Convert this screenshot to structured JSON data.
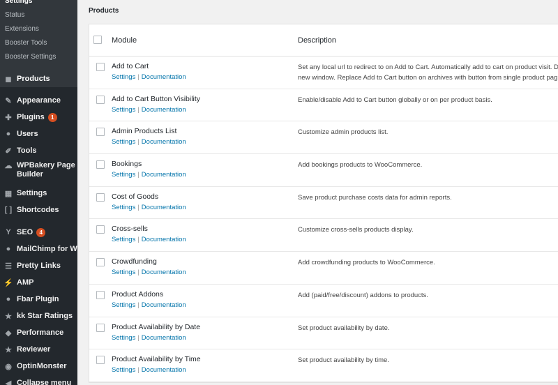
{
  "sidebar": {
    "submenu": [
      {
        "label": "Settings",
        "current": true
      },
      {
        "label": "Status"
      },
      {
        "label": "Extensions"
      },
      {
        "label": "Booster Tools"
      },
      {
        "label": "Booster Settings"
      }
    ],
    "menu": [
      {
        "label": "Products",
        "icon": "products-icon",
        "glyph": "◼"
      },
      {
        "label": "Appearance",
        "icon": "paintbrush-icon",
        "glyph": "✎"
      },
      {
        "label": "Plugins",
        "icon": "plugin-icon",
        "glyph": "✚",
        "badge": "1"
      },
      {
        "label": "Users",
        "icon": "users-icon",
        "glyph": "●"
      },
      {
        "label": "Tools",
        "icon": "wrench-icon",
        "glyph": "✐"
      },
      {
        "label": "WPBakery Page Builder",
        "icon": "wpbakery-icon",
        "glyph": "☁"
      },
      {
        "label": "Settings",
        "icon": "settings-icon",
        "glyph": "▦"
      },
      {
        "label": "Shortcodes",
        "icon": "shortcodes-icon",
        "glyph": "[ ]"
      },
      {
        "label": "SEO",
        "icon": "yoast-icon",
        "glyph": "Y",
        "badge": "4"
      },
      {
        "label": "MailChimp for WP",
        "icon": "mailchimp-icon",
        "glyph": "●"
      },
      {
        "label": "Pretty Links",
        "icon": "pretty-links-icon",
        "glyph": "☰"
      },
      {
        "label": "AMP",
        "icon": "amp-icon",
        "glyph": "⚡"
      },
      {
        "label": "Fbar Plugin",
        "icon": "fbar-icon",
        "glyph": "●"
      },
      {
        "label": "kk Star Ratings",
        "icon": "star-icon",
        "glyph": "★"
      },
      {
        "label": "Performance",
        "icon": "performance-icon",
        "glyph": "◆"
      },
      {
        "label": "Reviewer",
        "icon": "reviewer-icon",
        "glyph": "★"
      },
      {
        "label": "OptinMonster",
        "icon": "optinmonster-icon",
        "glyph": "◉"
      },
      {
        "label": "Collapse menu",
        "icon": "collapse-icon",
        "glyph": "◀"
      }
    ]
  },
  "main": {
    "section_title": "Products",
    "table": {
      "col_module": "Module",
      "col_description": "Description",
      "settings_label": "Settings",
      "docs_label": "Documentation",
      "separator": "|",
      "rows": [
        {
          "module": "Add to Cart",
          "description": "Set any local url to redirect to on Add to Cart. Automatically add to cart on product visit. D new window. Replace Add to Cart button on archives with button from single product pag"
        },
        {
          "module": "Add to Cart Button Visibility",
          "description": "Enable/disable Add to Cart button globally or on per product basis."
        },
        {
          "module": "Admin Products List",
          "description": "Customize admin products list."
        },
        {
          "module": "Bookings",
          "description": "Add bookings products to WooCommerce."
        },
        {
          "module": "Cost of Goods",
          "description": "Save product purchase costs data for admin reports."
        },
        {
          "module": "Cross-sells",
          "description": "Customize cross-sells products display."
        },
        {
          "module": "Crowdfunding",
          "description": "Add crowdfunding products to WooCommerce."
        },
        {
          "module": "Product Addons",
          "description": "Add (paid/free/discount) addons to products."
        },
        {
          "module": "Product Availability by Date",
          "description": "Set product availability by date."
        },
        {
          "module": "Product Availability by Time",
          "description": "Set product availability by time."
        }
      ]
    }
  }
}
